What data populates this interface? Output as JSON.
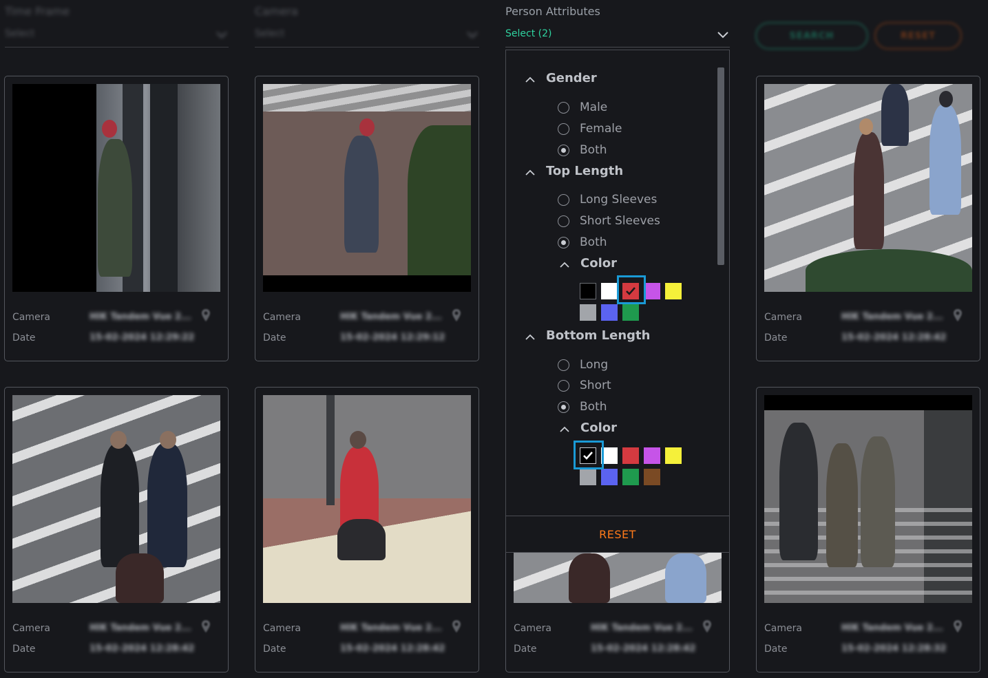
{
  "filters": {
    "time_frame": {
      "label": "Time Frame",
      "value": "Select"
    },
    "camera": {
      "label": "Camera",
      "value": "Select"
    },
    "person_attributes": {
      "label": "Person Attributes",
      "value": "Select (2)"
    }
  },
  "buttons": {
    "search": "SEARCH",
    "reset": "RESET"
  },
  "dropdown": {
    "gender": {
      "title": "Gender",
      "options": [
        "Male",
        "Female",
        "Both"
      ],
      "selected": "Both"
    },
    "top_length": {
      "title": "Top Length",
      "options": [
        "Long Sleeves",
        "Short Sleeves",
        "Both"
      ],
      "selected": "Both",
      "color_title": "Color",
      "colors": [
        "#000000",
        "#ffffff",
        "#d43a40",
        "#c654e8",
        "#f5f03a",
        "#a2a5aa",
        "#5b63f0",
        "#1f9a4e"
      ],
      "selected_color": "#d43a40"
    },
    "bottom_length": {
      "title": "Bottom Length",
      "options": [
        "Long",
        "Short",
        "Both"
      ],
      "selected": "Both",
      "color_title": "Color",
      "colors": [
        "#000000",
        "#ffffff",
        "#d43a40",
        "#c654e8",
        "#f5f03a",
        "#a2a5aa",
        "#5b63f0",
        "#1f9a4e",
        "#7a4a24"
      ],
      "selected_color": "#000000"
    },
    "reset_label": "RESET"
  },
  "cards": [
    {
      "camera_label": "Camera",
      "camera": "HIK Tandem Vue 2...",
      "date_label": "Date",
      "date": "15-02-2024 12:29:22"
    },
    {
      "camera_label": "Camera",
      "camera": "HIK Tandem Vue 2...",
      "date_label": "Date",
      "date": "15-02-2024 12:29:12"
    },
    {
      "camera_label": "Camera",
      "camera": "HIK Tandem Vue 2...",
      "date_label": "Date",
      "date": "15-02-2024 12:28:42"
    },
    {
      "camera_label": "Camera",
      "camera": "HIK Tandem Vue 2...",
      "date_label": "Date",
      "date": "15-02-2024 12:28:42"
    },
    {
      "camera_label": "Camera",
      "camera": "HIK Tandem Vue 2...",
      "date_label": "Date",
      "date": "15-02-2024 12:28:42"
    },
    {
      "camera_label": "Camera",
      "camera": "HIK Tandem Vue 2...",
      "date_label": "Date",
      "date": "15-02-2024 12:28:42"
    },
    {
      "camera_label": "Camera",
      "camera": "HIK Tandem Vue 2...",
      "date_label": "Date",
      "date": "15-02-2024 12:28:32"
    }
  ]
}
